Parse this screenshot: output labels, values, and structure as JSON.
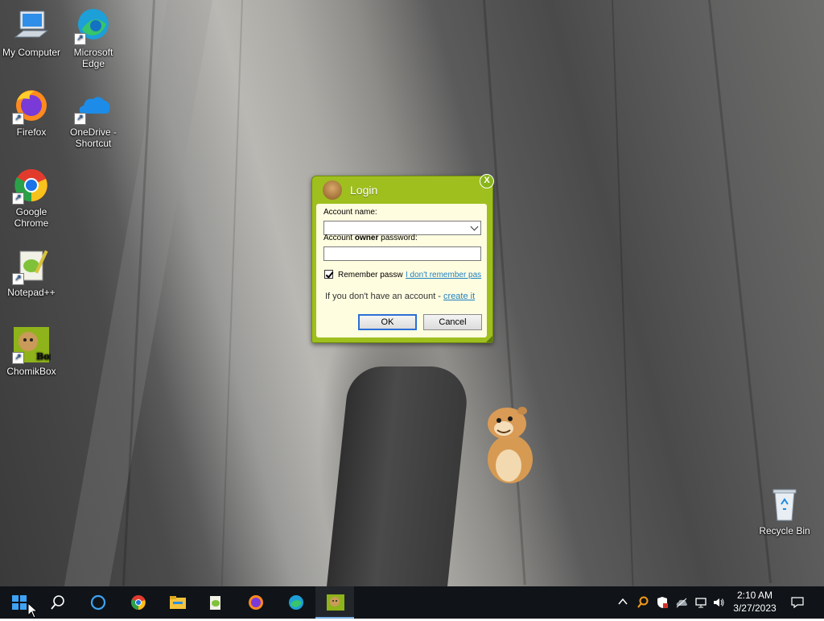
{
  "desktop": {
    "icons": [
      {
        "label": "My Computer"
      },
      {
        "label": "Microsoft Edge"
      },
      {
        "label": "Firefox"
      },
      {
        "label": "OneDrive - Shortcut"
      },
      {
        "label": "Google Chrome"
      },
      {
        "label": "Notepad++"
      },
      {
        "label": "ChomikBox"
      },
      {
        "label": "Recycle Bin"
      }
    ]
  },
  "dialog": {
    "title": "Login",
    "close_label": "X",
    "account_name_label": "Account name:",
    "account_name_value": "",
    "password_label_prefix": "Account ",
    "password_label_bold": "owner",
    "password_label_suffix": " password:",
    "password_value": "",
    "remember_checked": true,
    "remember_label": "Remember passw",
    "forgot_link": "I don't remember pas",
    "no_account_text": "If you don't have an account - ",
    "create_link": "create it",
    "ok_label": "OK",
    "cancel_label": "Cancel",
    "theme": {
      "frame": "#9fbf1f",
      "body": "#fffde0",
      "link": "#1f7fc0"
    }
  },
  "taskbar": {
    "items": [
      "start-icon",
      "search-icon",
      "cortana-icon",
      "chrome-icon",
      "file-explorer-icon",
      "notepadpp-icon",
      "firefox-icon",
      "edge-icon",
      "chomikbox-icon"
    ],
    "active_item": "chomikbox-icon",
    "clock_time": "2:10 AM",
    "clock_date": "3/27/2023"
  }
}
